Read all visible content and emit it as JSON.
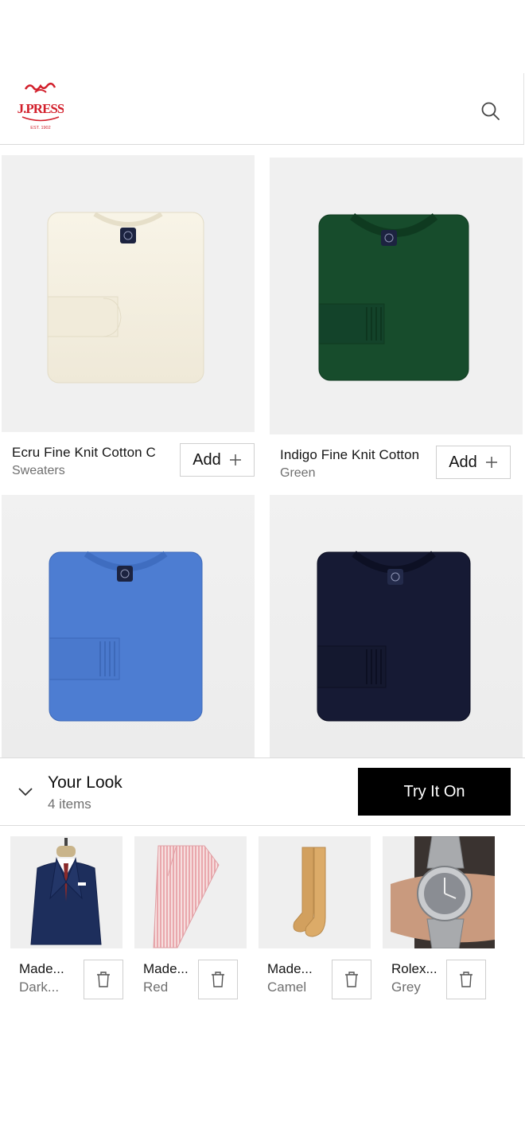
{
  "header": {
    "logo_alt": "J.PRESS EST. 1902",
    "logo_icon": "j-press-logo"
  },
  "products": [
    {
      "name": "Ecru Fine Knit Cotton C",
      "category": "Sweaters",
      "add_label": "Add",
      "color": "#f7f3e6"
    },
    {
      "name": "Indigo Fine Knit Cotton",
      "category": "Green",
      "add_label": "Add",
      "color": "#164a2b"
    },
    {
      "name": "",
      "category": "",
      "add_label": "",
      "color": "#4f7fd3"
    },
    {
      "name": "",
      "category": "",
      "add_label": "",
      "color": "#161a33"
    }
  ],
  "look": {
    "title": "Your Look",
    "count": "4 items",
    "try_label": "Try It On",
    "items": [
      {
        "name": "Made...",
        "color": "Dark..."
      },
      {
        "name": "Made...",
        "color": "Red"
      },
      {
        "name": "Made...",
        "color": "Camel"
      },
      {
        "name": "Rolex...",
        "color": "Grey"
      }
    ]
  },
  "colors": {
    "accent_red": "#d21f2b",
    "button_black": "#000000"
  }
}
